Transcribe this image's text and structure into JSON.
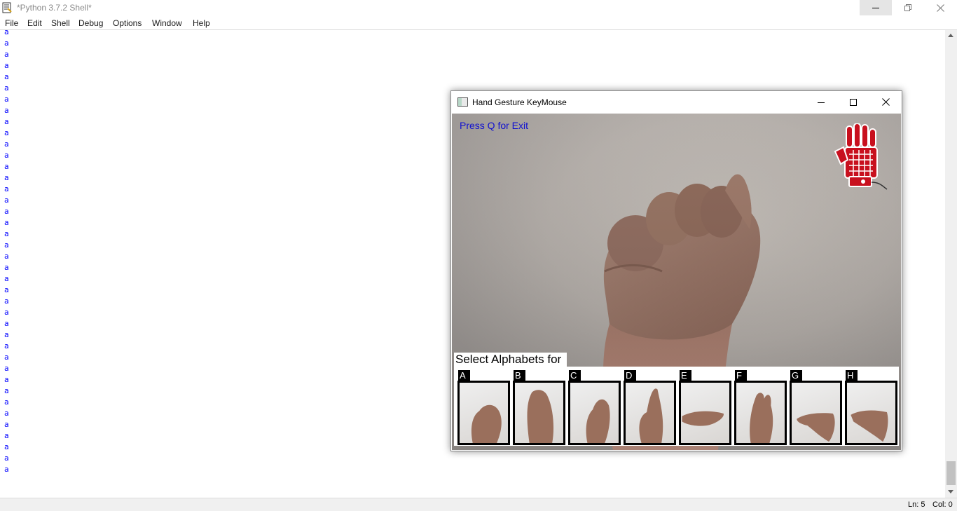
{
  "window": {
    "title": "*Python 3.7.2 Shell*"
  },
  "menu": [
    "File",
    "Edit",
    "Shell",
    "Debug",
    "Options",
    "Window",
    "Help"
  ],
  "shell": {
    "output_char": "a",
    "line_count": 40
  },
  "status": {
    "line": "Ln: 5",
    "col": "Col: 0"
  },
  "gesture_window": {
    "title": "Hand Gesture KeyMouse",
    "exit_hint": "Press Q for Exit",
    "select_label": "Select Alphabets for",
    "letters": [
      "A",
      "B",
      "C",
      "D",
      "E",
      "F",
      "G",
      "H"
    ]
  },
  "colors": {
    "shell_text": "#0000ff",
    "exit_text": "#1010d0",
    "logo_red": "#c8101e"
  },
  "icons": [
    "idle-app-icon",
    "minimize-icon",
    "restore-icon",
    "close-icon",
    "maximize-icon",
    "hand-logo-icon"
  ]
}
